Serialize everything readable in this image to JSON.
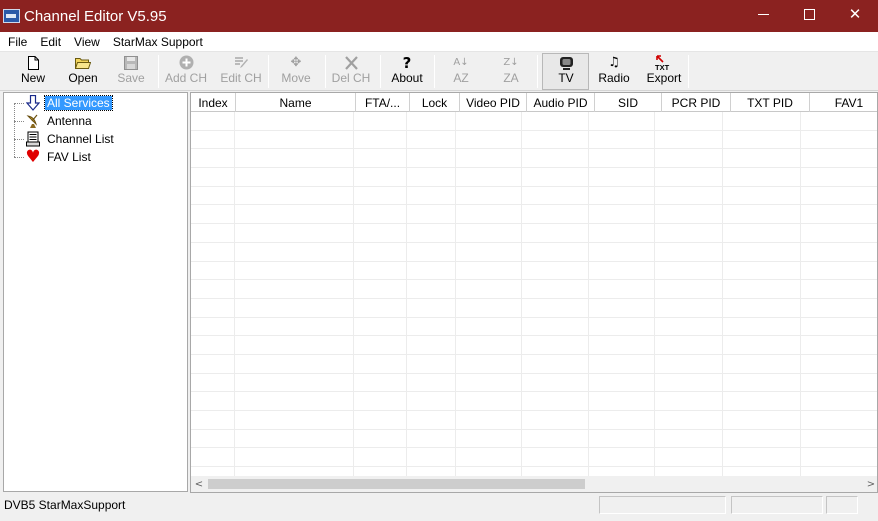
{
  "window": {
    "title": "Channel Editor V5.95",
    "controls": {
      "minimize": "—",
      "maximize": "□",
      "close": "✕"
    }
  },
  "menu": {
    "items": [
      "File",
      "Edit",
      "View",
      "StarMax Support"
    ]
  },
  "toolbar": {
    "buttons": [
      {
        "label": "New",
        "icon": "new-document-icon",
        "glyph": "🗋",
        "enabled": true
      },
      {
        "label": "Open",
        "icon": "open-folder-icon",
        "glyph": "📂",
        "enabled": true
      },
      {
        "label": "Save",
        "icon": "save-disk-icon",
        "glyph": "💾",
        "enabled": false
      },
      {
        "label": "Add CH",
        "icon": "add-circle-icon",
        "glyph": "⊕",
        "enabled": false
      },
      {
        "label": "Edit CH",
        "icon": "edit-icon",
        "glyph": "✎",
        "enabled": false
      },
      {
        "label": "Move",
        "icon": "move-arrows-icon",
        "glyph": "✥",
        "enabled": false
      },
      {
        "label": "Del CH",
        "icon": "delete-x-icon",
        "glyph": "✕",
        "enabled": false
      },
      {
        "label": "About",
        "icon": "about-question-icon",
        "glyph": "?",
        "enabled": true
      },
      {
        "label": "AZ",
        "icon": "sort-az-icon",
        "glyph": "A↓",
        "enabled": false
      },
      {
        "label": "ZA",
        "icon": "sort-za-icon",
        "glyph": "Z↓",
        "enabled": false
      },
      {
        "label": "TV",
        "icon": "tv-icon",
        "glyph": "▣",
        "enabled": true,
        "pressed": true
      },
      {
        "label": "Radio",
        "icon": "radio-note-icon",
        "glyph": "♫",
        "enabled": true
      },
      {
        "label": "Export",
        "icon": "export-txt-icon",
        "glyph": "TXT",
        "enabled": true
      }
    ]
  },
  "tree": {
    "items": [
      {
        "label": "All Services",
        "icon": "down-arrow-icon",
        "glyph": "⇩",
        "selected": true
      },
      {
        "label": "Antenna",
        "icon": "satellite-dish-icon",
        "glyph": "📡",
        "selected": false
      },
      {
        "label": "Channel List",
        "icon": "channel-list-icon",
        "glyph": "☰",
        "selected": false
      },
      {
        "label": "FAV List",
        "icon": "heart-icon",
        "glyph": "♥",
        "selected": false
      }
    ]
  },
  "grid": {
    "columns": [
      "Index",
      "Name",
      "FTA/...",
      "Lock",
      "Video PID",
      "Audio PID",
      "SID",
      "PCR PID",
      "TXT PID",
      "FAV1"
    ],
    "rows": []
  },
  "scrollbar": {
    "left_arrow": "<",
    "right_arrow": ">"
  },
  "status": {
    "text": "DVB5 StarMaxSupport"
  },
  "colors": {
    "titlebar": "#8b2220",
    "selection": "#3399ff",
    "heart": "#e00000"
  }
}
